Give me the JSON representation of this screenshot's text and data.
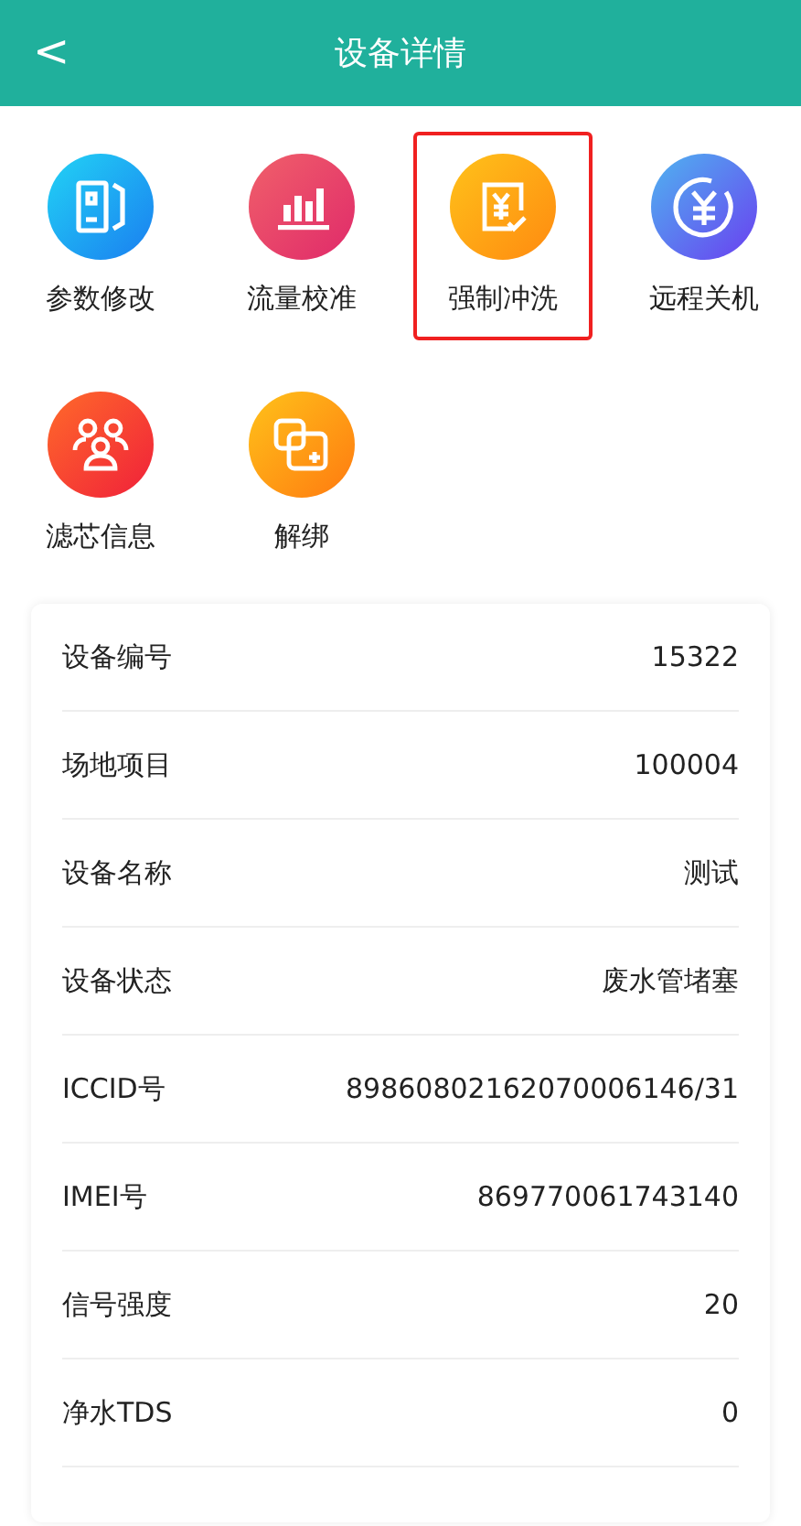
{
  "header": {
    "back": "<",
    "title": "设备详情"
  },
  "actions": [
    {
      "kind": "params",
      "label": "参数修改",
      "selected": false
    },
    {
      "kind": "flow",
      "label": "流量校准",
      "selected": false
    },
    {
      "kind": "flush",
      "label": "强制冲洗",
      "selected": true
    },
    {
      "kind": "power",
      "label": "远程关机",
      "selected": false
    },
    {
      "kind": "filter",
      "label": "滤芯信息",
      "selected": false
    },
    {
      "kind": "unbind",
      "label": "解绑",
      "selected": false
    }
  ],
  "details": [
    {
      "label": "设备编号",
      "value": "15322"
    },
    {
      "label": "场地项目",
      "value": "100004"
    },
    {
      "label": "设备名称",
      "value": "测试"
    },
    {
      "label": "设备状态",
      "value": "废水管堵塞"
    },
    {
      "label": "ICCID号",
      "value": "89860802162070006146/31"
    },
    {
      "label": "IMEI号",
      "value": "869770061743140"
    },
    {
      "label": "信号强度",
      "value": "20"
    },
    {
      "label": "净水TDS",
      "value": "0"
    }
  ]
}
